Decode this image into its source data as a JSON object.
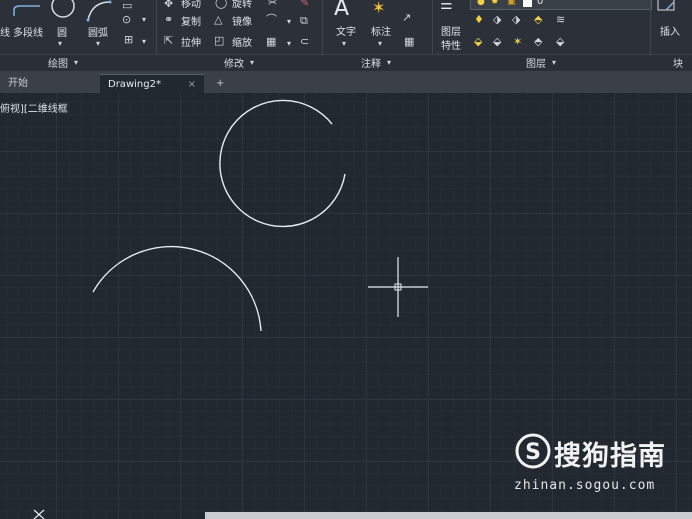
{
  "ribbon": {
    "draw_panel": {
      "title": "绘图",
      "items": [
        "线",
        "多段线",
        "圆",
        "圆弧"
      ]
    },
    "modify_panel": {
      "title": "修改",
      "items": [
        "移动",
        "旋转",
        "复制",
        "镜像",
        "拉伸",
        "缩放"
      ]
    },
    "annotate_panel": {
      "title": "注释",
      "items": [
        "文字",
        "标注"
      ]
    },
    "layer_panel": {
      "title": "图层",
      "layer_properties_line1": "图层",
      "layer_properties_line2": "特性",
      "current_layer": "0"
    },
    "block_panel": {
      "title": "块",
      "insert_label": "插入"
    }
  },
  "tabs": [
    {
      "label": "开始",
      "active": false
    },
    {
      "label": "Drawing2*",
      "active": true
    }
  ],
  "tab_close_glyph": "×",
  "tab_add_glyph": "+",
  "viewport_label": "俯视][二维线框",
  "watermark": {
    "brand": "搜狗指南",
    "url": "zhinan.sogou.com"
  },
  "colors": {
    "canvas_bg": "#212830",
    "ribbon_bg": "#2c3139",
    "geometry": "#e8ecf0"
  }
}
